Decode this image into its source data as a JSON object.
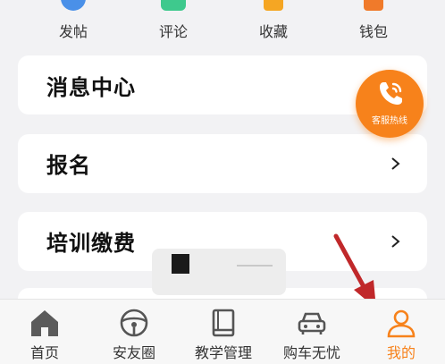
{
  "quick_actions": [
    {
      "label": "发帖",
      "icon": "post-icon"
    },
    {
      "label": "评论",
      "icon": "comment-icon"
    },
    {
      "label": "收藏",
      "icon": "favorite-icon"
    },
    {
      "label": "钱包",
      "icon": "wallet-icon"
    }
  ],
  "menu": [
    {
      "title": "消息中心"
    },
    {
      "title": "报名"
    },
    {
      "title": "培训缴费"
    }
  ],
  "hotline": {
    "label": "客服热线",
    "icon": "phone-icon"
  },
  "tabs": [
    {
      "label": "首页",
      "icon": "home-icon"
    },
    {
      "label": "安友圈",
      "icon": "steering-wheel-icon"
    },
    {
      "label": "教学管理",
      "icon": "book-icon"
    },
    {
      "label": "购车无忧",
      "icon": "car-icon"
    },
    {
      "label": "我的",
      "icon": "person-icon"
    }
  ],
  "colors": {
    "accent": "#f7821b",
    "arrow": "#c0282a",
    "card": "#ffffff",
    "background": "#f2f2f4"
  }
}
